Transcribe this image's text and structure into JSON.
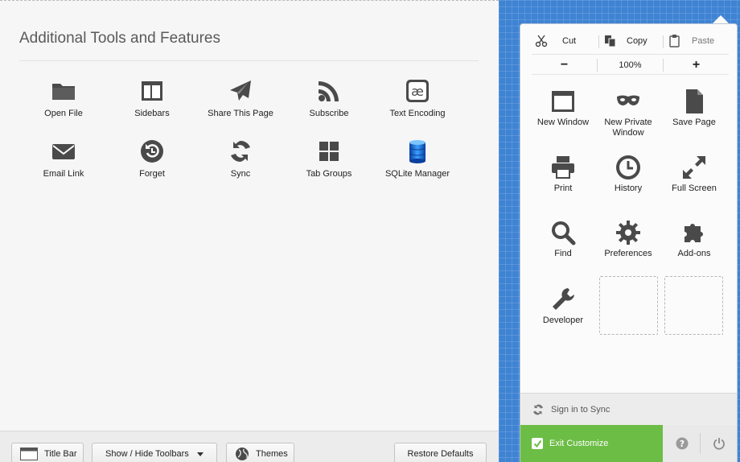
{
  "palette": {
    "title": "Additional Tools and Features",
    "items": [
      {
        "label": "Open File",
        "icon": "folder-icon"
      },
      {
        "label": "Sidebars",
        "icon": "sidebar-icon"
      },
      {
        "label": "Share This Page",
        "icon": "paper-plane-icon"
      },
      {
        "label": "Subscribe",
        "icon": "rss-icon"
      },
      {
        "label": "Text Encoding",
        "icon": "ae-glyph-icon"
      },
      {
        "label": "Email Link",
        "icon": "envelope-icon"
      },
      {
        "label": "Forget",
        "icon": "forget-history-icon"
      },
      {
        "label": "Sync",
        "icon": "sync-icon"
      },
      {
        "label": "Tab Groups",
        "icon": "tab-groups-icon"
      },
      {
        "label": "SQLite Manager",
        "icon": "database-icon"
      }
    ]
  },
  "bottom_bar": {
    "title_bar": "Title Bar",
    "show_hide": "Show / Hide Toolbars",
    "themes": "Themes",
    "restore": "Restore Defaults"
  },
  "menu": {
    "edit": {
      "cut": "Cut",
      "copy": "Copy",
      "paste": "Paste"
    },
    "zoom": {
      "minus": "−",
      "level": "100%",
      "plus": "+"
    },
    "items": [
      {
        "label": "New Window",
        "icon": "window-icon"
      },
      {
        "label": "New Private Window",
        "icon": "private-mask-icon"
      },
      {
        "label": "Save Page",
        "icon": "document-icon"
      },
      {
        "label": "Print",
        "icon": "printer-icon"
      },
      {
        "label": "History",
        "icon": "clock-icon"
      },
      {
        "label": "Full Screen",
        "icon": "fullscreen-arrows-icon"
      },
      {
        "label": "Find",
        "icon": "magnifier-icon"
      },
      {
        "label": "Preferences",
        "icon": "gear-icon"
      },
      {
        "label": "Add-ons",
        "icon": "puzzle-icon"
      },
      {
        "label": "Developer",
        "icon": "wrench-icon"
      }
    ],
    "sign_in": "Sign in to Sync",
    "exit": "Exit Customize"
  },
  "colors": {
    "exit_green": "#6cbd45",
    "grid_blue": "#3f83d3",
    "icon_gray": "#4a4a4a"
  }
}
